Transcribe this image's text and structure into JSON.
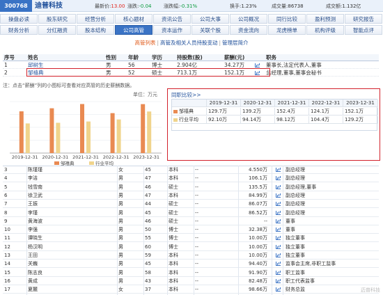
{
  "header": {
    "code": "300768",
    "name": "迪普科技",
    "quotes": [
      {
        "label": "最新价:",
        "value": "13.00",
        "cls": "v-up"
      },
      {
        "label": "涨跌:",
        "value": "-0.04",
        "cls": "v-down"
      },
      {
        "label": "涨跌幅:",
        "value": "-0.31%",
        "cls": "v-down"
      },
      {
        "label": "换手:",
        "value": "1.23%",
        "cls": "v-plain"
      },
      {
        "label": "成交量:",
        "value": "86738",
        "cls": "v-plain"
      },
      {
        "label": "成交额:",
        "value": "1.132亿",
        "cls": "v-plain"
      }
    ]
  },
  "nav": {
    "row1": [
      "操盘必读",
      "股东研究",
      "经营分析",
      "核心题材",
      "资讯公告",
      "公司大事",
      "公司概况",
      "同行比较",
      "盈利预测",
      "研究报告"
    ],
    "row2": [
      "财务分析",
      "分红融资",
      "股本结构",
      "公司高管",
      "资本运作",
      "关联个股",
      "资金流向",
      "龙虎榜单",
      "机构评级",
      "智能点评"
    ],
    "active_row2": 3
  },
  "subtabs": {
    "items": [
      "高管列表",
      "高管及相关人员持股变动",
      "管理层简介"
    ],
    "sep": "|"
  },
  "main_table": {
    "headers": [
      "序号",
      "姓名",
      "性别",
      "年龄",
      "学历",
      "持股数(股)",
      "薪酬(元)",
      "职务"
    ],
    "rows": [
      [
        "1",
        "邱树生",
        "男",
        "56",
        "博士",
        "2.904亿",
        "34.27万",
        "董事长,法定代表人,董事"
      ],
      [
        "2",
        "邹禧典",
        "男",
        "52",
        "硕士",
        "713.1万",
        "152.1万",
        "总经理,董事,董事会秘书"
      ]
    ]
  },
  "note": "注：点击“薪酬”列的小图标可查看对应高管的历史薪酬数据。",
  "chart_data": {
    "type": "bar",
    "unit": "单位：万元",
    "categories": [
      "2019-12-31",
      "2020-12-31",
      "2021-12-31",
      "2022-12-31",
      "2023-12-31"
    ],
    "series": [
      {
        "name": "邹禧典",
        "values": [
          129.7,
          139.2,
          152.4,
          124.1,
          152.1
        ],
        "color": "#e98a52"
      },
      {
        "name": "行业平均",
        "values": [
          92.1,
          94.14,
          98.12,
          104.4,
          129.2
        ],
        "color": "#f0d48c"
      }
    ],
    "ylim": [
      0,
      160
    ],
    "grid": true,
    "legend": "bottom"
  },
  "compare": {
    "title": "同职比较>>",
    "headers": [
      "",
      "2019-12-31",
      "2020-12-31",
      "2021-12-31",
      "2022-12-31",
      "2023-12-31"
    ],
    "rows": [
      {
        "name": "邹禧典",
        "color": "#e98a52",
        "values": [
          "129.7万",
          "139.2万",
          "152.4万",
          "124.1万",
          "152.1万"
        ]
      },
      {
        "name": "行业平均",
        "color": "#f0d48c",
        "values": [
          "92.10万",
          "94.14万",
          "98.12万",
          "104.4万",
          "129.2万"
        ]
      }
    ]
  },
  "list": [
    [
      "3",
      "陈瑾瑾",
      "女",
      "45",
      "本科",
      "--",
      "4.550万",
      "副总经理"
    ],
    [
      "4",
      "李洁",
      "男",
      "47",
      "本科",
      "--",
      "106.1万",
      "副总经理"
    ],
    [
      "5",
      "钱雪南",
      "男",
      "46",
      "硕士",
      "--",
      "135.5万",
      "副总经理,董事"
    ],
    [
      "6",
      "徐卫武",
      "男",
      "47",
      "本科",
      "--",
      "84.99万",
      "副总经理"
    ],
    [
      "7",
      "王振",
      "男",
      "44",
      "硕士",
      "--",
      "86.07万",
      "副总经理"
    ],
    [
      "8",
      "李瑾",
      "男",
      "45",
      "硕士",
      "--",
      "86.52万",
      "副总经理"
    ],
    [
      "9",
      "黄海波",
      "男",
      "46",
      "硕士",
      "--",
      "--",
      "董事"
    ],
    [
      "10",
      "李强",
      "男",
      "50",
      "博士",
      "--",
      "32.38万",
      "董事"
    ],
    [
      "11",
      "谭晓生",
      "男",
      "55",
      "博士",
      "--",
      "10.00万",
      "独立董事"
    ],
    [
      "12",
      "杨汉明",
      "男",
      "60",
      "博士",
      "--",
      "10.00万",
      "独立董事"
    ],
    [
      "13",
      "王田",
      "男",
      "59",
      "本科",
      "--",
      "10.00万",
      "独立董事"
    ],
    [
      "14",
      "关巍",
      "男",
      "45",
      "本科",
      "--",
      "94.40万",
      "监事会主席,非职工监事"
    ],
    [
      "15",
      "陈志良",
      "男",
      "58",
      "本科",
      "--",
      "91.90万",
      "职工监事"
    ],
    [
      "16",
      "黄成",
      "男",
      "43",
      "本科",
      "--",
      "82.48万",
      "职工代表监事"
    ],
    [
      "17",
      "夏麓",
      "女",
      "37",
      "本科",
      "--",
      "98.66万",
      "财务总监"
    ]
  ],
  "watermark": "迈普科技"
}
